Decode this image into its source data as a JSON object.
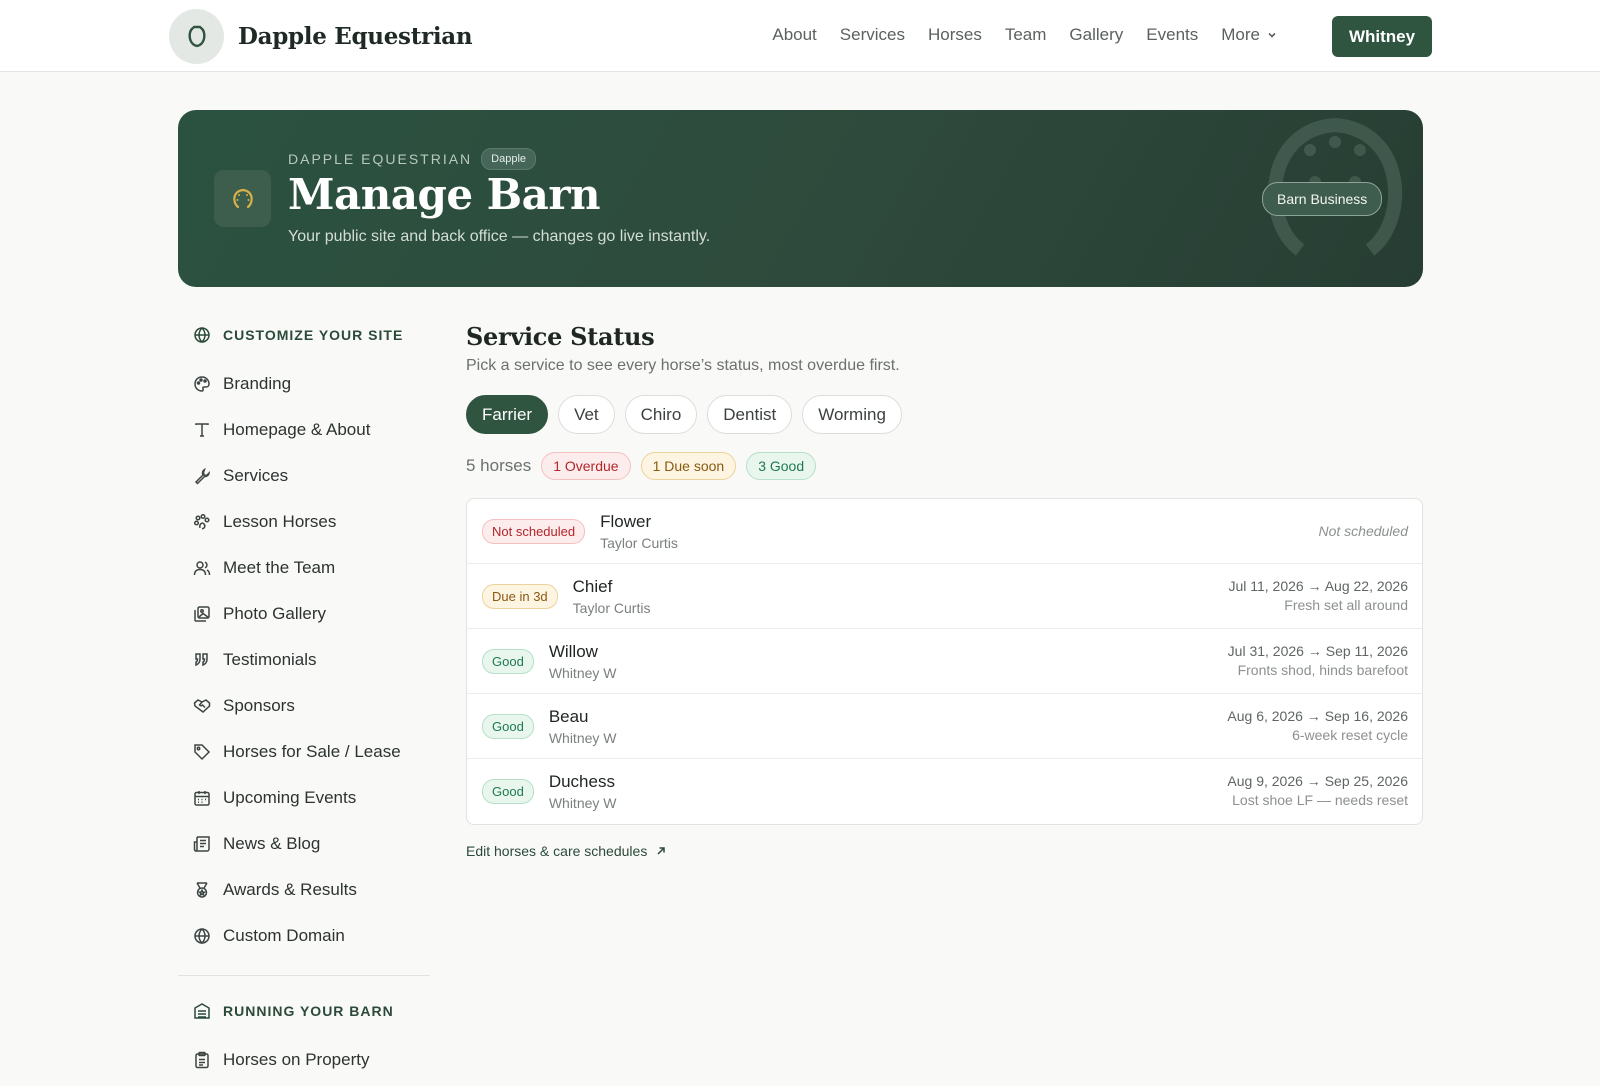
{
  "brand": {
    "name": "Dapple Equestrian",
    "logo_icon": "horseshoe-icon"
  },
  "nav": {
    "links": [
      "About",
      "Services",
      "Horses",
      "Team",
      "Gallery",
      "Events"
    ],
    "more_label": "More",
    "user_label": "Whitney"
  },
  "hero": {
    "eyebrow": "DAPPLE EQUESTRIAN",
    "eyebrow_badge": "Dapple",
    "title": "Manage Barn",
    "subtitle": "Your public site and back office — changes go live instantly.",
    "plan_pill": "Barn Business",
    "icon": "horseshoe-icon"
  },
  "sidebar": {
    "section1": {
      "heading": "CUSTOMIZE YOUR SITE",
      "icon": "globe-icon",
      "items": [
        {
          "label": "Branding",
          "icon": "palette-icon"
        },
        {
          "label": "Homepage & About",
          "icon": "type-icon"
        },
        {
          "label": "Services",
          "icon": "wrench-icon"
        },
        {
          "label": "Lesson Horses",
          "icon": "paw-icon"
        },
        {
          "label": "Meet the Team",
          "icon": "users-icon"
        },
        {
          "label": "Photo Gallery",
          "icon": "images-icon"
        },
        {
          "label": "Testimonials",
          "icon": "quote-icon"
        },
        {
          "label": "Sponsors",
          "icon": "handshake-icon"
        },
        {
          "label": "Horses for Sale / Lease",
          "icon": "tag-icon"
        },
        {
          "label": "Upcoming Events",
          "icon": "calendar-icon"
        },
        {
          "label": "News & Blog",
          "icon": "newspaper-icon"
        },
        {
          "label": "Awards & Results",
          "icon": "medal-icon"
        },
        {
          "label": "Custom Domain",
          "icon": "globe-icon"
        }
      ]
    },
    "section2": {
      "heading": "RUNNING YOUR BARN",
      "icon": "building-icon",
      "items": [
        {
          "label": "Horses on Property",
          "icon": "clipboard-icon"
        }
      ]
    }
  },
  "main": {
    "title": "Service Status",
    "subtitle": "Pick a service to see every horse’s status, most overdue first.",
    "tabs": [
      {
        "label": "Farrier",
        "active": true
      },
      {
        "label": "Vet",
        "active": false
      },
      {
        "label": "Chiro",
        "active": false
      },
      {
        "label": "Dentist",
        "active": false
      },
      {
        "label": "Worming",
        "active": false
      }
    ],
    "counts": {
      "total": "5 horses",
      "overdue": "1 Overdue",
      "due_soon": "1 Due soon",
      "good": "3 Good"
    },
    "rows": [
      {
        "status": "Not scheduled",
        "tone": "red",
        "name": "Flower",
        "owner": "Taylor Curtis",
        "dates": "",
        "note": "Not scheduled"
      },
      {
        "status": "Due in 3d",
        "tone": "amber",
        "name": "Chief",
        "owner": "Taylor Curtis",
        "dates": "Jul 11, 2026 → Aug 22, 2026",
        "note": "Fresh set all around"
      },
      {
        "status": "Good",
        "tone": "green",
        "name": "Willow",
        "owner": "Whitney W",
        "dates": "Jul 31, 2026 → Sep 11, 2026",
        "note": "Fronts shod, hinds barefoot"
      },
      {
        "status": "Good",
        "tone": "green",
        "name": "Beau",
        "owner": "Whitney W",
        "dates": "Aug 6, 2026 → Sep 16, 2026",
        "note": "6-week reset cycle"
      },
      {
        "status": "Good",
        "tone": "green",
        "name": "Duchess",
        "owner": "Whitney W",
        "dates": "Aug 9, 2026 → Sep 25, 2026",
        "note": "Lost shoe LF — needs reset"
      }
    ],
    "edit_link": "Edit horses & care schedules",
    "edit_link_icon": "arrow-up-right-icon"
  }
}
